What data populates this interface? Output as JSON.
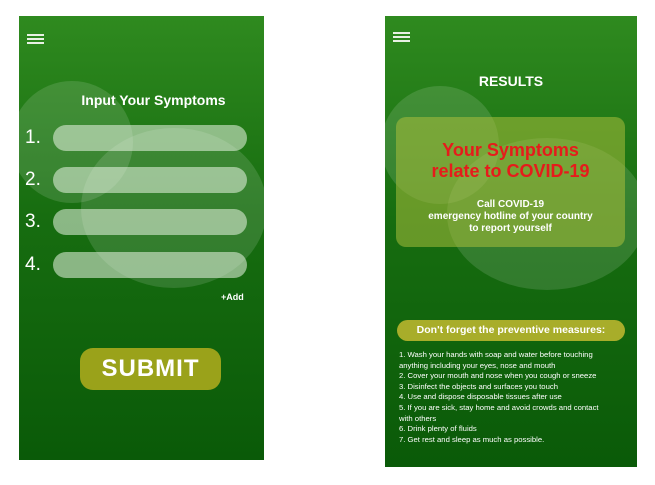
{
  "symptoms_screen": {
    "title": "Input Your Symptoms",
    "fields": [
      {
        "number": "1.",
        "value": ""
      },
      {
        "number": "2.",
        "value": ""
      },
      {
        "number": "3.",
        "value": ""
      },
      {
        "number": "4.",
        "value": ""
      }
    ],
    "add_label": "+Add",
    "submit_label": "SUBMIT"
  },
  "results_screen": {
    "title": "RESULTS",
    "headline_line1": "Your Symptoms",
    "headline_line2": "relate to COVID-19",
    "advice_line1": "Call COVID-19",
    "advice_line2": "emergency hotline of your country",
    "advice_line3": "to report yourself",
    "measures_title": "Don't forget the preventive measures:",
    "measures": [
      "1. Wash your hands with soap and water before touching",
      "anything including your eyes, nose and mouth",
      "2. Cover your mouth and nose when you cough or sneeze",
      "3. Disinfect the objects and surfaces you touch",
      "4. Use and dispose disposable tissues after use",
      "5. If you are sick, stay home and avoid crowds and contact",
      " with others",
      "6. Drink plenty of fluids",
      "7. Get rest and sleep as much as possible."
    ]
  },
  "colors": {
    "screen_green": "#176d10",
    "accent_olive": "#9aa21a",
    "alert_red": "#e61b1b"
  }
}
